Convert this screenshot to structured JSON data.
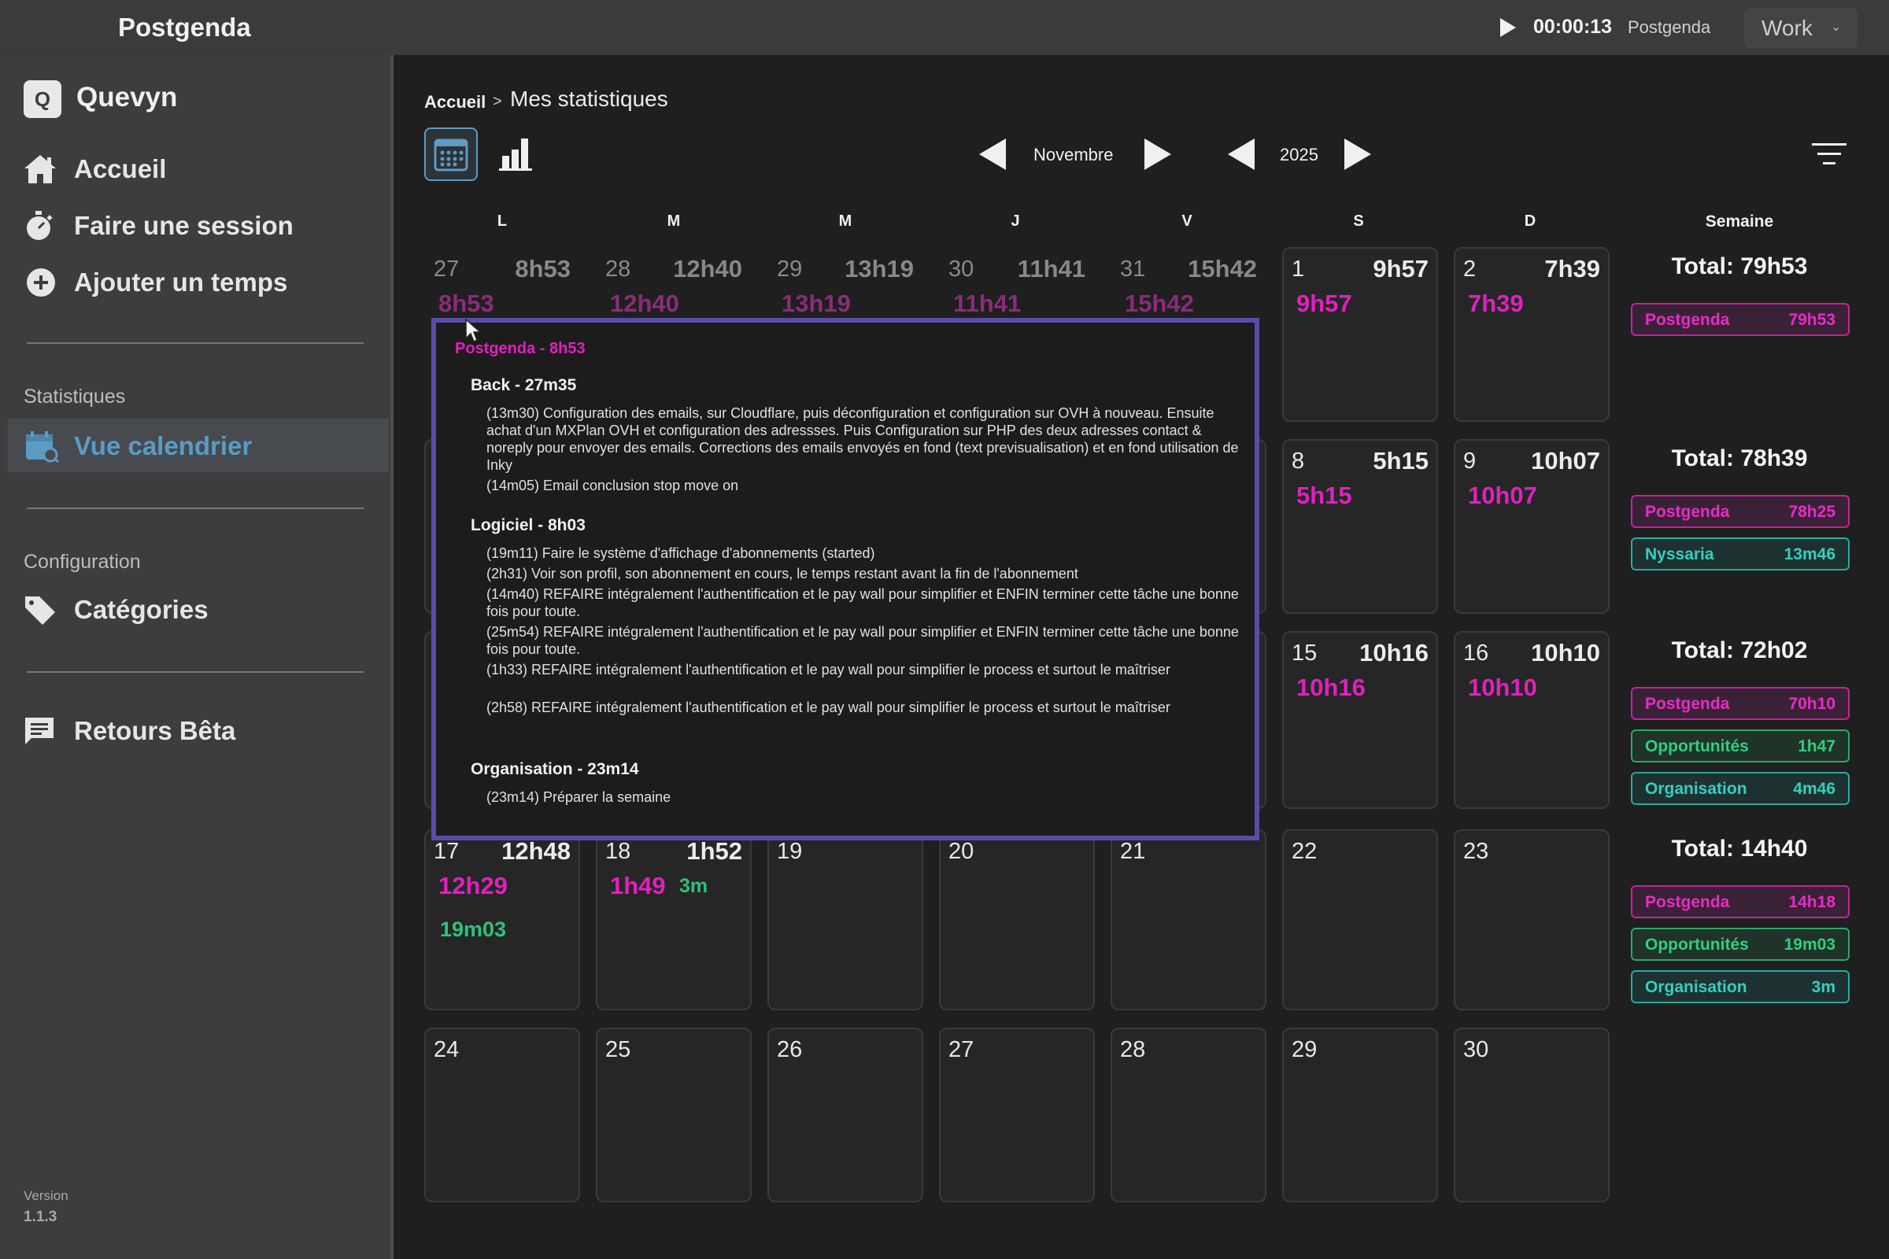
{
  "titlebar": {
    "app_title": "Postgenda",
    "timer": "00:00:13",
    "current_app": "Postgenda",
    "workspace": "Work"
  },
  "sidebar": {
    "workspace_letter": "Q",
    "workspace_name": "Quevyn",
    "items": [
      {
        "label": "Accueil",
        "icon": "home-icon"
      },
      {
        "label": "Faire une session",
        "icon": "stopwatch-icon"
      },
      {
        "label": "Ajouter un temps",
        "icon": "plus-circle-icon"
      }
    ],
    "stats_section": "Statistiques",
    "stats_items": [
      {
        "label": "Vue calendrier",
        "icon": "calendar-search-icon",
        "active": true
      }
    ],
    "config_section": "Configuration",
    "config_items": [
      {
        "label": "Catégories",
        "icon": "tag-icon"
      }
    ],
    "feedback": {
      "label": "Retours Bêta",
      "icon": "chat-icon"
    },
    "version_label": "Version",
    "version": "1.1.3"
  },
  "breadcrumb": {
    "home": "Accueil",
    "separator": ">",
    "current": "Mes statistiques"
  },
  "nav": {
    "month": "Novembre",
    "year": "2025"
  },
  "days_of_week": [
    "L",
    "M",
    "M",
    "J",
    "V",
    "S",
    "D"
  ],
  "week_header": "Semaine",
  "calendar": {
    "weeks": [
      {
        "days": [
          {
            "day": "27",
            "total": "8h53",
            "cat": "8h53",
            "dim": true
          },
          {
            "day": "28",
            "total": "12h40",
            "cat": "12h40",
            "dim": true
          },
          {
            "day": "29",
            "total": "13h19",
            "cat": "13h19",
            "dim": true
          },
          {
            "day": "30",
            "total": "11h41",
            "cat": "11h41",
            "dim": true
          },
          {
            "day": "31",
            "total": "15h42",
            "cat": "15h42",
            "dim": true
          },
          {
            "day": "1",
            "total": "9h57",
            "cat": "9h57"
          },
          {
            "day": "2",
            "total": "7h39",
            "cat": "7h39"
          }
        ]
      },
      {
        "days": [
          {
            "day": "",
            "total": "",
            "cat": ""
          },
          {
            "day": "",
            "total": "",
            "cat": ""
          },
          {
            "day": "",
            "total": "",
            "cat": ""
          },
          {
            "day": "",
            "total": "",
            "cat": ""
          },
          {
            "day": "",
            "total": "",
            "cat": ""
          },
          {
            "day": "8",
            "total": "5h15",
            "cat": "5h15"
          },
          {
            "day": "9",
            "total": "10h07",
            "cat": "10h07"
          }
        ]
      },
      {
        "days": [
          {
            "day": "",
            "total": "",
            "cat": ""
          },
          {
            "day": "",
            "total": "",
            "cat": ""
          },
          {
            "day": "",
            "total": "",
            "cat": ""
          },
          {
            "day": "",
            "total": "",
            "cat": ""
          },
          {
            "day": "",
            "total": "",
            "cat": ""
          },
          {
            "day": "15",
            "total": "10h16",
            "cat": "10h16"
          },
          {
            "day": "16",
            "total": "10h10",
            "cat": "10h10"
          }
        ]
      },
      {
        "days": [
          {
            "day": "17",
            "total": "12h48",
            "cat": "12h29",
            "cat2": "19m03"
          },
          {
            "day": "18",
            "total": "1h52",
            "cat": "1h49",
            "cat2": "3m",
            "inline": true
          },
          {
            "day": "19",
            "total": "",
            "cat": ""
          },
          {
            "day": "20",
            "total": "",
            "cat": ""
          },
          {
            "day": "21",
            "total": "",
            "cat": ""
          },
          {
            "day": "22",
            "total": "",
            "cat": ""
          },
          {
            "day": "23",
            "total": "",
            "cat": ""
          }
        ]
      },
      {
        "days": [
          {
            "day": "24",
            "total": "",
            "cat": ""
          },
          {
            "day": "25",
            "total": "",
            "cat": ""
          },
          {
            "day": "26",
            "total": "",
            "cat": ""
          },
          {
            "day": "27",
            "total": "",
            "cat": ""
          },
          {
            "day": "28",
            "total": "",
            "cat": ""
          },
          {
            "day": "29",
            "total": "",
            "cat": ""
          },
          {
            "day": "30",
            "total": "",
            "cat": ""
          }
        ]
      }
    ],
    "week_totals": [
      {
        "total": "Total: 79h53",
        "badges": [
          {
            "name": "Postgenda",
            "value": "79h53",
            "kind": "pink"
          }
        ]
      },
      {
        "total": "Total: 78h39",
        "badges": [
          {
            "name": "Postgenda",
            "value": "78h25",
            "kind": "pink"
          },
          {
            "name": "Nyssaria",
            "value": "13m46",
            "kind": "teal"
          }
        ]
      },
      {
        "total": "Total: 72h02",
        "badges": [
          {
            "name": "Postgenda",
            "value": "70h10",
            "kind": "pink"
          },
          {
            "name": "Opportunités",
            "value": "1h47",
            "kind": "green"
          },
          {
            "name": "Organisation",
            "value": "4m46",
            "kind": "teal"
          }
        ]
      },
      {
        "total": "Total: 14h40",
        "badges": [
          {
            "name": "Postgenda",
            "value": "14h18",
            "kind": "pink"
          },
          {
            "name": "Opportunités",
            "value": "19m03",
            "kind": "green"
          },
          {
            "name": "Organisation",
            "value": "3m",
            "kind": "teal"
          }
        ]
      }
    ]
  },
  "popover": {
    "heading": "Postgenda - 8h53",
    "groups": [
      {
        "title": "Back - 27m35",
        "lines": [
          "(13m30) Configuration des emails, sur Cloudflare, puis déconfiguration et configuration sur OVH à nouveau. Ensuite achat d'un MXPlan OVH et configuration des adressses. Puis Configuration sur PHP des deux adresses contact & noreply pour envoyer des emails. Corrections des emails envoyés en fond (text previsualisation) et en fond utilisation de Inky",
          "(14m05) Email conclusion stop move on"
        ]
      },
      {
        "title": "Logiciel - 8h03",
        "lines": [
          "(19m11) Faire le système d'affichage d'abonnements (started)",
          "(2h31) Voir son profil, son abonnement en cours, le temps restant avant la fin de l'abonnement",
          "(14m40) REFAIRE intégralement l'authentification et le pay wall pour simplifier et ENFIN terminer cette tâche une bonne fois pour toute.",
          "(25m54) REFAIRE intégralement l'authentification et le pay wall pour simplifier et ENFIN terminer cette tâche une bonne fois pour toute.",
          "(1h33) REFAIRE intégralement l'authentification et le pay wall pour simplifier le process et surtout le maîtriser",
          "(2h58) REFAIRE intégralement l'authentification et le pay wall pour simplifier le process et surtout le maîtriser"
        ]
      },
      {
        "title": "Organisation - 23m14",
        "lines": [
          "(23m14) Préparer la semaine"
        ]
      }
    ]
  },
  "colors": {
    "accent": "#5b9bc4",
    "category_pink": "#e020c0",
    "category_green": "#2ec27a",
    "popover_border": "#5a4ba8"
  }
}
